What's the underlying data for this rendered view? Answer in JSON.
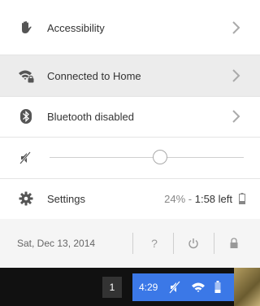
{
  "menu": {
    "accessibility_label": "Accessibility",
    "network_label": "Connected to Home",
    "bluetooth_label": "Bluetooth disabled",
    "volume_level": 0.57,
    "settings_label": "Settings",
    "battery_percent": "24% -",
    "battery_time": "1:58 left"
  },
  "footer": {
    "date": "Sat, Dec 13, 2014",
    "help_label": "?"
  },
  "shelf": {
    "notification_count": "1",
    "time": "4:29"
  },
  "colors": {
    "tray_blue": "#3b78e7",
    "shelf_bg": "#111111",
    "hover_row": "#ececec"
  }
}
